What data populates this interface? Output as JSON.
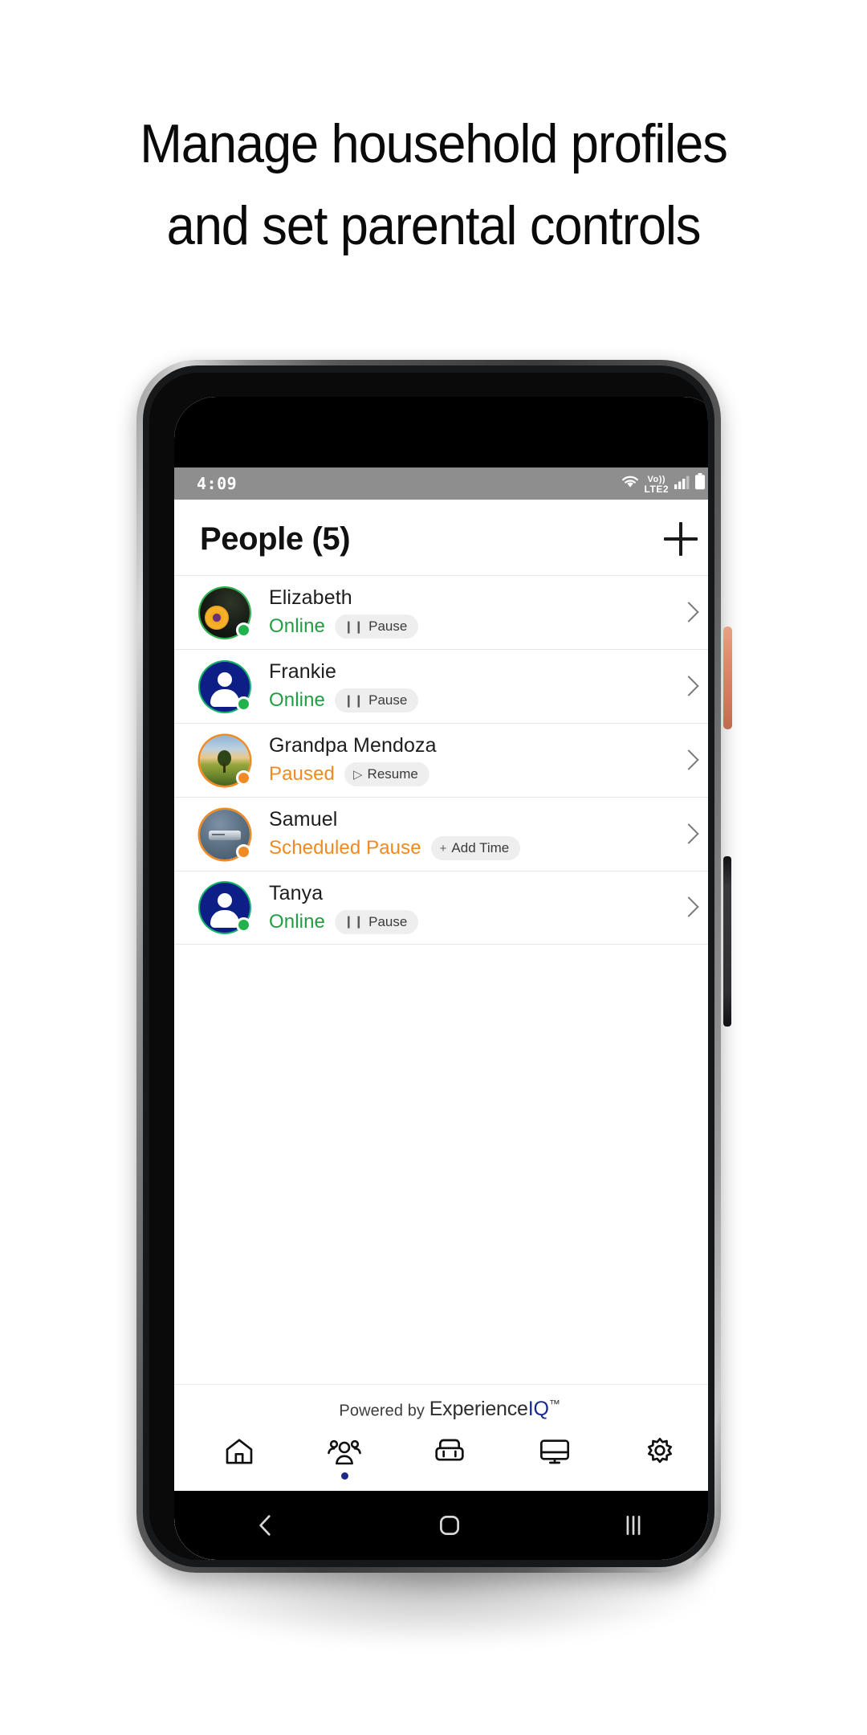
{
  "headline": {
    "line1": "Manage household profiles",
    "line2": "and set parental controls"
  },
  "phone": {
    "status_bar": {
      "time": "4:09",
      "wifi_icon": "wifi-icon",
      "volte_top": "Vo))",
      "volte_bottom": "LTE2",
      "signal_icon": "signal-bars-icon",
      "battery_icon": "battery-icon"
    },
    "app": {
      "header": {
        "title": "People (5)",
        "add_label": "+"
      },
      "people": [
        {
          "name": "Elizabeth",
          "status": "Online",
          "status_kind": "online",
          "chip_label": "Pause",
          "chip_glyph": "❙❙",
          "avatar": "flower-photo-avatar",
          "dot": "green"
        },
        {
          "name": "Frankie",
          "status": "Online",
          "status_kind": "online",
          "chip_label": "Pause",
          "chip_glyph": "❙❙",
          "avatar": "person-silhouette-avatar",
          "dot": "green"
        },
        {
          "name": "Grandpa Mendoza",
          "status": "Paused",
          "status_kind": "paused",
          "chip_label": "Resume",
          "chip_glyph": "▷",
          "avatar": "landscape-photo-avatar",
          "dot": "orange"
        },
        {
          "name": "Samuel",
          "status": "Scheduled Pause",
          "status_kind": "paused",
          "chip_label": "Add Time",
          "chip_glyph": "+",
          "avatar": "device-photo-avatar",
          "dot": "orange"
        },
        {
          "name": "Tanya",
          "status": "Online",
          "status_kind": "online",
          "chip_label": "Pause",
          "chip_glyph": "❙❙",
          "avatar": "person-silhouette-avatar",
          "dot": "green"
        }
      ],
      "footer": {
        "powered_prefix": "Powered by ",
        "brand_main": "Experience",
        "brand_accent": "IQ",
        "brand_tm": "™"
      },
      "bottom_nav": [
        {
          "name": "home",
          "icon": "home-icon",
          "active": false
        },
        {
          "name": "people",
          "icon": "people-icon",
          "active": true
        },
        {
          "name": "network",
          "icon": "router-icon",
          "active": false
        },
        {
          "name": "devices",
          "icon": "monitor-icon",
          "active": false
        },
        {
          "name": "settings",
          "icon": "gear-icon",
          "active": false
        }
      ]
    },
    "android_nav": {
      "back": "back-icon",
      "home": "home-circle-icon",
      "recents": "recents-icon"
    }
  },
  "colors": {
    "online_green": "#1f9e42",
    "paused_orange": "#ef8a20",
    "brand_blue": "#1b2a8a",
    "status_bar_gray": "#8e8e8e",
    "power_button": "#d3795a"
  }
}
